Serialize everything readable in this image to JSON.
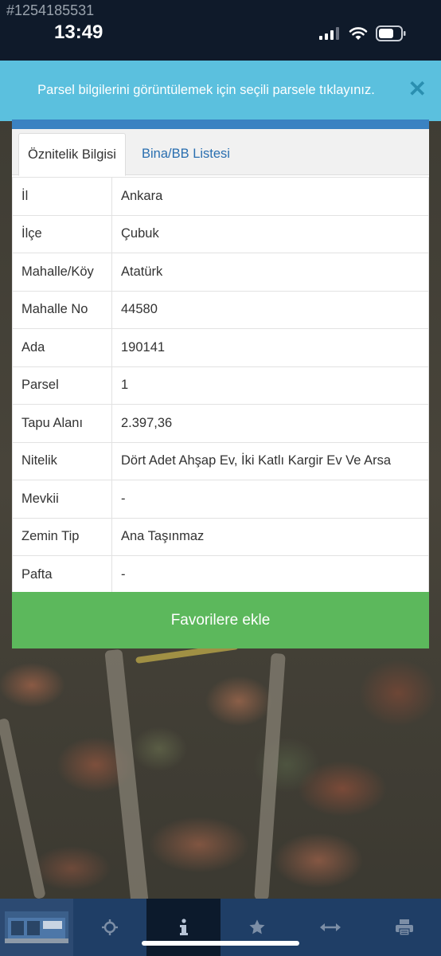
{
  "status_bar": {
    "listing_id": "#1254185531",
    "time": "13:49"
  },
  "banner": {
    "text": "Parsel bilgilerini görüntülemek için seçili parsele tıklayınız.",
    "close_icon": "close-icon"
  },
  "tabs": [
    {
      "label": "Öznitelik Bilgisi",
      "active": true
    },
    {
      "label": "Bina/BB Listesi",
      "active": false
    }
  ],
  "attributes": [
    {
      "key": "İl",
      "value": "Ankara"
    },
    {
      "key": "İlçe",
      "value": "Çubuk"
    },
    {
      "key": "Mahalle/Köy",
      "value": "Atatürk"
    },
    {
      "key": "Mahalle No",
      "value": "44580"
    },
    {
      "key": "Ada",
      "value": "190141"
    },
    {
      "key": "Parsel",
      "value": "1"
    },
    {
      "key": "Tapu Alanı",
      "value": "2.397,36"
    },
    {
      "key": "Nitelik",
      "value": "Dört Adet Ahşap Ev, İki Katlı Kargir Ev Ve Arsa"
    },
    {
      "key": "Mevkii",
      "value": "-"
    },
    {
      "key": "Zemin Tip",
      "value": "Ana Taşınmaz"
    },
    {
      "key": "Pafta",
      "value": "-"
    }
  ],
  "favorite_button": "Favorilere ekle",
  "toolbar": {
    "items": [
      "logo-thumbnail",
      "locate-icon",
      "info-icon",
      "star-icon",
      "measure-icon",
      "print-icon"
    ],
    "active": "info-icon"
  },
  "colors": {
    "banner": "#5bc0de",
    "panel_top": "#3a82c2",
    "favorite": "#5cb85c",
    "toolbar": "#1f3e66",
    "tab_link": "#2a6fb0"
  }
}
